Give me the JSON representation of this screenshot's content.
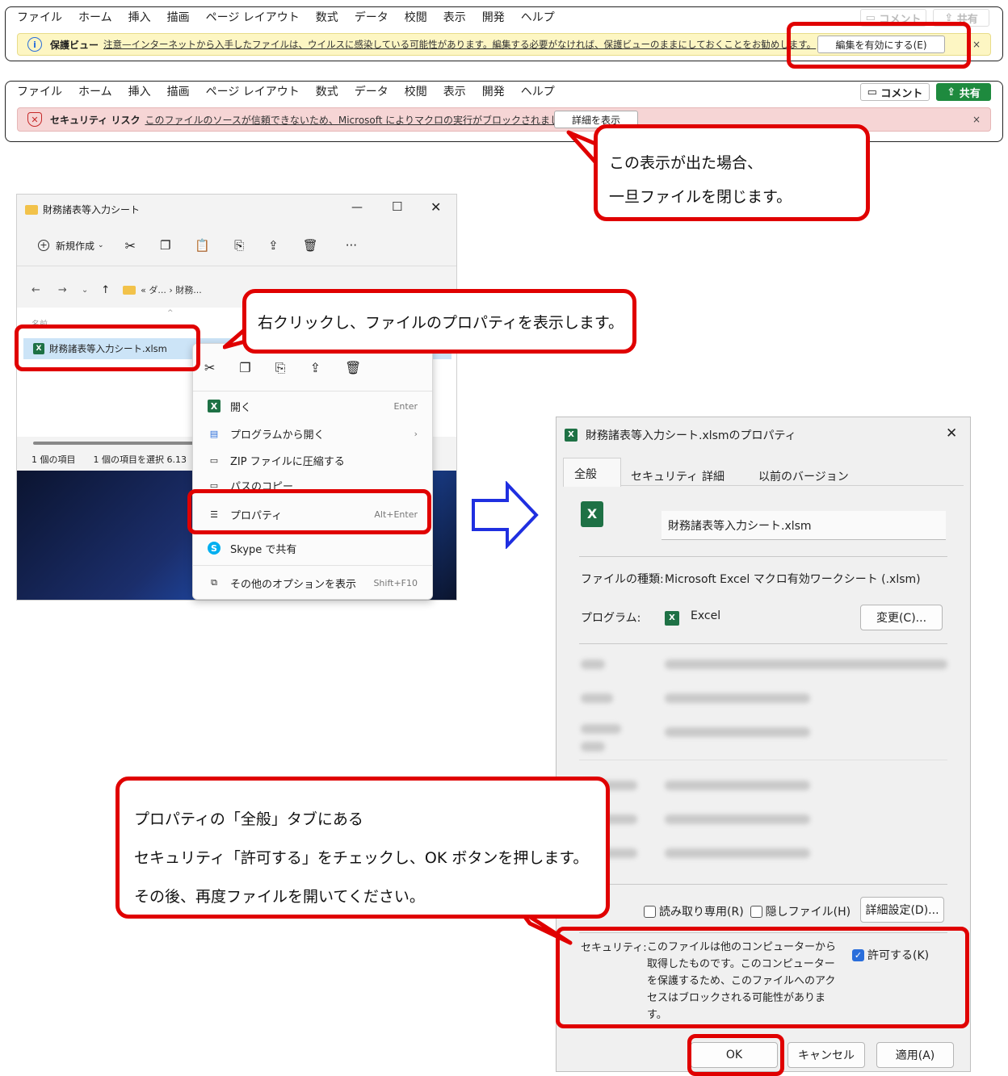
{
  "ribbon1": {
    "menu": [
      "ファイル",
      "ホーム",
      "挿入",
      "描画",
      "ページ レイアウト",
      "数式",
      "データ",
      "校閲",
      "表示",
      "開発",
      "ヘルプ"
    ],
    "comment_label": "コメント",
    "share_label": "共有",
    "banner_title": "保護ビュー",
    "banner_text": "注意—インターネットから入手したファイルは、ウイルスに感染している可能性があります。編集する必要がなければ、保護ビューのままにしておくことをお勧めします。",
    "enable_button": "編集を有効にする(E)",
    "close": "×"
  },
  "ribbon2": {
    "menu": [
      "ファイル",
      "ホーム",
      "挿入",
      "描画",
      "ページ レイアウト",
      "数式",
      "データ",
      "校閲",
      "表示",
      "開発",
      "ヘルプ"
    ],
    "comment_label": "コメント",
    "share_label": "共有",
    "banner_title": "セキュリティ リスク",
    "banner_text": "このファイルのソースが信頼できないため、Microsoft によりマクロの実行がブロックされました。",
    "details_button": "詳細を表示",
    "close": "×"
  },
  "callout1": {
    "line1": "この表示が出た場合、",
    "line2": "一旦ファイルを閉じます。"
  },
  "callout2": {
    "text": "右クリックし、ファイルのプロパティを表示します。"
  },
  "callout3": {
    "line1": "プロパティの「全般」タブにある",
    "line2": "セキュリティ「許可する」をチェックし、OK ボタンを押します。",
    "line3": "その後、再度ファイルを開いてください。"
  },
  "explorer": {
    "title": "財務諸表等入力シート",
    "new_button": "新規作成",
    "breadcrumb": "« ダ... › 財務...",
    "column_name": "名前",
    "file_name": "財務諸表等入力シート.xlsm",
    "status_count": "1 個の項目",
    "status_selected": "1 個の項目を選択 6.13"
  },
  "context_menu": {
    "items": [
      {
        "icon": "excel-icon",
        "label": "開く",
        "shortcut": "Enter"
      },
      {
        "icon": "open-with-icon",
        "label": "プログラムから開く",
        "shortcut": "›"
      },
      {
        "icon": "zip-icon",
        "label": "ZIP ファイルに圧縮する",
        "shortcut": ""
      },
      {
        "icon": "copy-path-icon",
        "label": "パスのコピー",
        "shortcut": ""
      },
      {
        "icon": "properties-icon",
        "label": "プロパティ",
        "shortcut": "Alt+Enter"
      },
      {
        "icon": "skype-icon",
        "label": "Skype で共有",
        "shortcut": ""
      },
      {
        "icon": "more-options-icon",
        "label": "その他のオプションを表示",
        "shortcut": "Shift+F10"
      }
    ]
  },
  "properties": {
    "title": "財務諸表等入力シート.xlsmのプロパティ",
    "tabs": [
      "全般",
      "セキュリティ",
      "詳細",
      "以前のバージョン"
    ],
    "file_name": "財務諸表等入力シート.xlsm",
    "type_label": "ファイルの種類:",
    "type_value": "Microsoft Excel マクロ有効ワークシート (.xlsm)",
    "program_label": "プログラム:",
    "program_value": "Excel",
    "change_button": "変更(C)...",
    "readonly_label": "読み取り専用(R)",
    "hidden_label": "隠しファイル(H)",
    "advanced_button": "詳細設定(D)...",
    "security_label": "セキュリティ:",
    "security_text": "このファイルは他のコンピューターから取得したものです。このコンピューターを保護するため、このファイルへのアクセスはブロックされる可能性があります。",
    "allow_label": "許可する(K)",
    "allow_checked": true,
    "ok_button": "OK",
    "cancel_button": "キャンセル",
    "apply_button": "適用(A)"
  }
}
